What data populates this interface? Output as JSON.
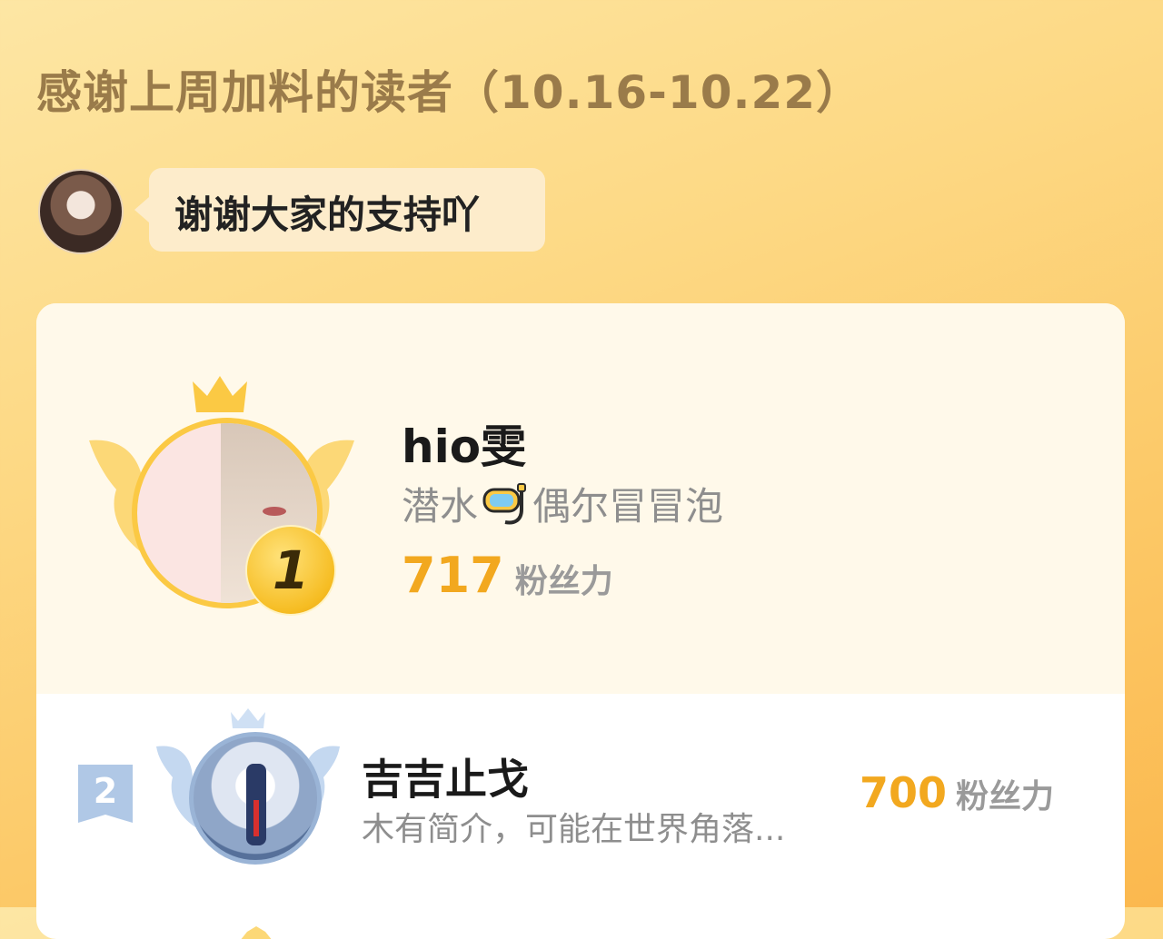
{
  "header": {
    "title": "感谢上周加料的读者（10.16-10.22）"
  },
  "host": {
    "message": "谢谢大家的支持吖"
  },
  "ranking": [
    {
      "rank": "1",
      "name": "hio雯",
      "bio_before_icon": "潜水",
      "bio_icon": "snorkel-icon",
      "bio_after_icon": "偶尔冒冒泡",
      "score": "717",
      "unit": "粉丝力"
    },
    {
      "rank": "2",
      "name": "吉吉止戈",
      "bio": "木有简介，可能在世界角落...",
      "score": "700",
      "unit": "粉丝力"
    }
  ],
  "colors": {
    "gold": "#f2a81f",
    "silver_badge": "#b0c8e6",
    "panel_top": "#fff9ea"
  }
}
